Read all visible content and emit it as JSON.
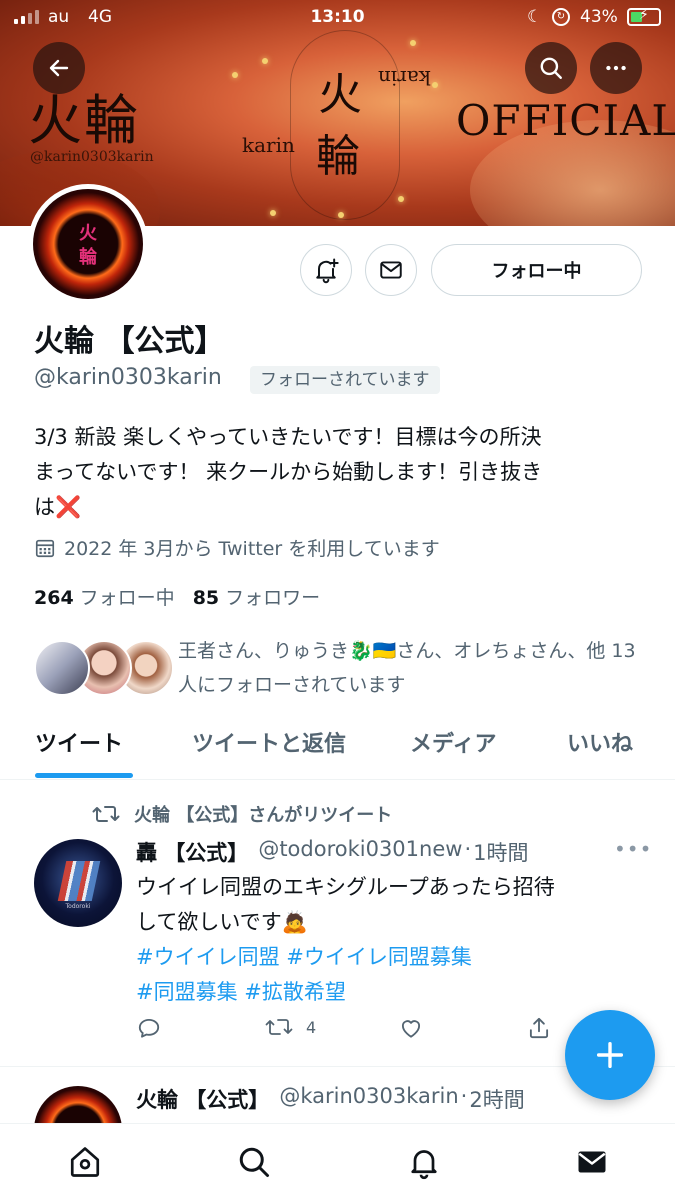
{
  "status_bar": {
    "carrier": "au",
    "network": "4G",
    "time": "13:10",
    "battery_percent": "43%",
    "battery_level": 0.43,
    "icons": [
      "signal-icon",
      "moon-icon",
      "orientation-lock-icon",
      "battery-charging-icon"
    ]
  },
  "header": {
    "back_icon": "arrow-left-icon",
    "search_icon": "search-icon",
    "more_icon": "more-horizontal-icon",
    "banner": {
      "logo_kanji": "火輪",
      "logo_handle": "@karin0303karin",
      "center_kanji_top": "火",
      "center_kanji_bottom": "輪",
      "center_romaji": "karin",
      "center_romaji_inverted": "karin",
      "official": "OFFICIAL"
    }
  },
  "profile": {
    "avatar_kanji_top": "火",
    "avatar_kanji_bottom": "輪",
    "display_name": "火輪 【公式】",
    "handle": "@karin0303karin",
    "follows_you": "フォローされています",
    "follow_button": "フォロー中",
    "bio": {
      "line1": "3/3 新設 楽しくやっていきたいです！目標は今の所決",
      "line2": "まってないです！ 来クールから始動します！引き抜き",
      "line3_prefix": "は",
      "line3_emoji": "❌"
    },
    "joined": "2022 年 3月から Twitter を利用しています",
    "following_count": "264",
    "following_label": "フォロー中",
    "followers_count": "85",
    "followers_label": "フォロワー",
    "mutuals_text": "王者さん、りゅうき🐉🇺🇦さん、オレちょさん、他 13 人にフォローされています"
  },
  "tabs": [
    {
      "label": "ツイート",
      "active": true
    },
    {
      "label": "ツイートと返信",
      "active": false
    },
    {
      "label": "メディア",
      "active": false
    },
    {
      "label": "いいね",
      "active": false
    }
  ],
  "tweets": [
    {
      "retweeted_by": "火輪 【公式】さんがリツイート",
      "author_name": "轟 【公式】",
      "author_handle": "@todoroki0301new",
      "time": "1時間",
      "more": "•••",
      "avatar_caption": "Todoroki",
      "text_line1": "ウイイレ同盟のエキシグループあったら招待",
      "text_line2": "して欲しいです🙇",
      "hashtags_line1": "#ウイイレ同盟 #ウイイレ同盟募集",
      "hashtags_line2": "#同盟募集 #拡散希望",
      "reply_count": "",
      "retweet_count": "4",
      "like_count": ""
    },
    {
      "author_name": "火輪 【公式】",
      "author_handle": "@karin0303karin",
      "time": "2時間"
    }
  ],
  "fab_icon": "compose-plus-icon",
  "bottom_nav": [
    {
      "name": "home",
      "icon": "home-icon"
    },
    {
      "name": "search",
      "icon": "search-icon"
    },
    {
      "name": "notifications",
      "icon": "bell-icon"
    },
    {
      "name": "messages",
      "icon": "mail-icon"
    }
  ],
  "colors": {
    "accent": "#1d9bf0",
    "text_primary": "#0f1419",
    "text_secondary": "#536471",
    "border": "#cfd9de",
    "banner_base": "#d8623a"
  }
}
